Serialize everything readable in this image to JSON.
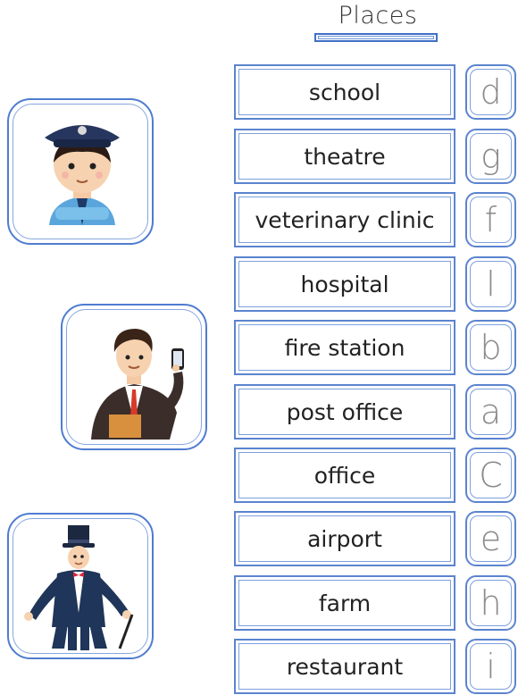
{
  "title": "Places",
  "places": [
    {
      "place": "school",
      "letter": "d"
    },
    {
      "place": "theatre",
      "letter": "g"
    },
    {
      "place": "veterinary clinic",
      "letter": "f"
    },
    {
      "place": "hospital",
      "letter": "l"
    },
    {
      "place": "fire station",
      "letter": "b"
    },
    {
      "place": "post office",
      "letter": "a"
    },
    {
      "place": "office",
      "letter": "C"
    },
    {
      "place": "airport",
      "letter": "e"
    },
    {
      "place": "farm",
      "letter": "h"
    },
    {
      "place": "restaurant",
      "letter": "i"
    }
  ],
  "pictures": [
    {
      "icon": "police-officer-icon"
    },
    {
      "icon": "businessman-icon"
    },
    {
      "icon": "magician-icon"
    }
  ]
}
